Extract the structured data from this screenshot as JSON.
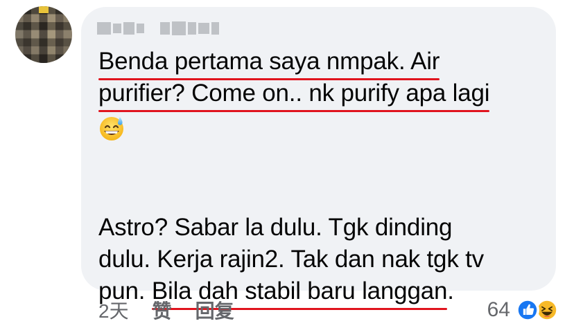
{
  "comment": {
    "author_name": "",
    "lines": [
      {
        "plain": "",
        "underlined": "Benda pertama saya nmpak. Air",
        "after": ""
      },
      {
        "plain": "",
        "underlined": "purifier? Come on.. nk purify apa lagi",
        "after": ""
      },
      {
        "plain": "",
        "underlined": "",
        "after": ""
      },
      {
        "plain": "Astro? Sabar la dulu. Tgk dinding",
        "underlined": "",
        "after": ""
      },
      {
        "plain": "dulu. Kerja rajin2. Tak dan nak tgk tv",
        "underlined": "",
        "after": ""
      },
      {
        "plain": "pun. ",
        "underlined": "Bila dah stabil baru langgan",
        "after": "."
      }
    ],
    "emoji": "grinning-face-with-sweat-icon",
    "underline_color": "#e0141e"
  },
  "actions": {
    "time": "2天",
    "like_label": "赞",
    "reply_label": "回复"
  },
  "reactions": {
    "count": "64",
    "icons": [
      "like-reaction-icon",
      "haha-reaction-icon"
    ],
    "like_color": "#1877f2",
    "haha_color": "#f7b928"
  },
  "colors": {
    "bubble": "#f0f2f5",
    "text": "#050505",
    "meta": "#65676b"
  }
}
